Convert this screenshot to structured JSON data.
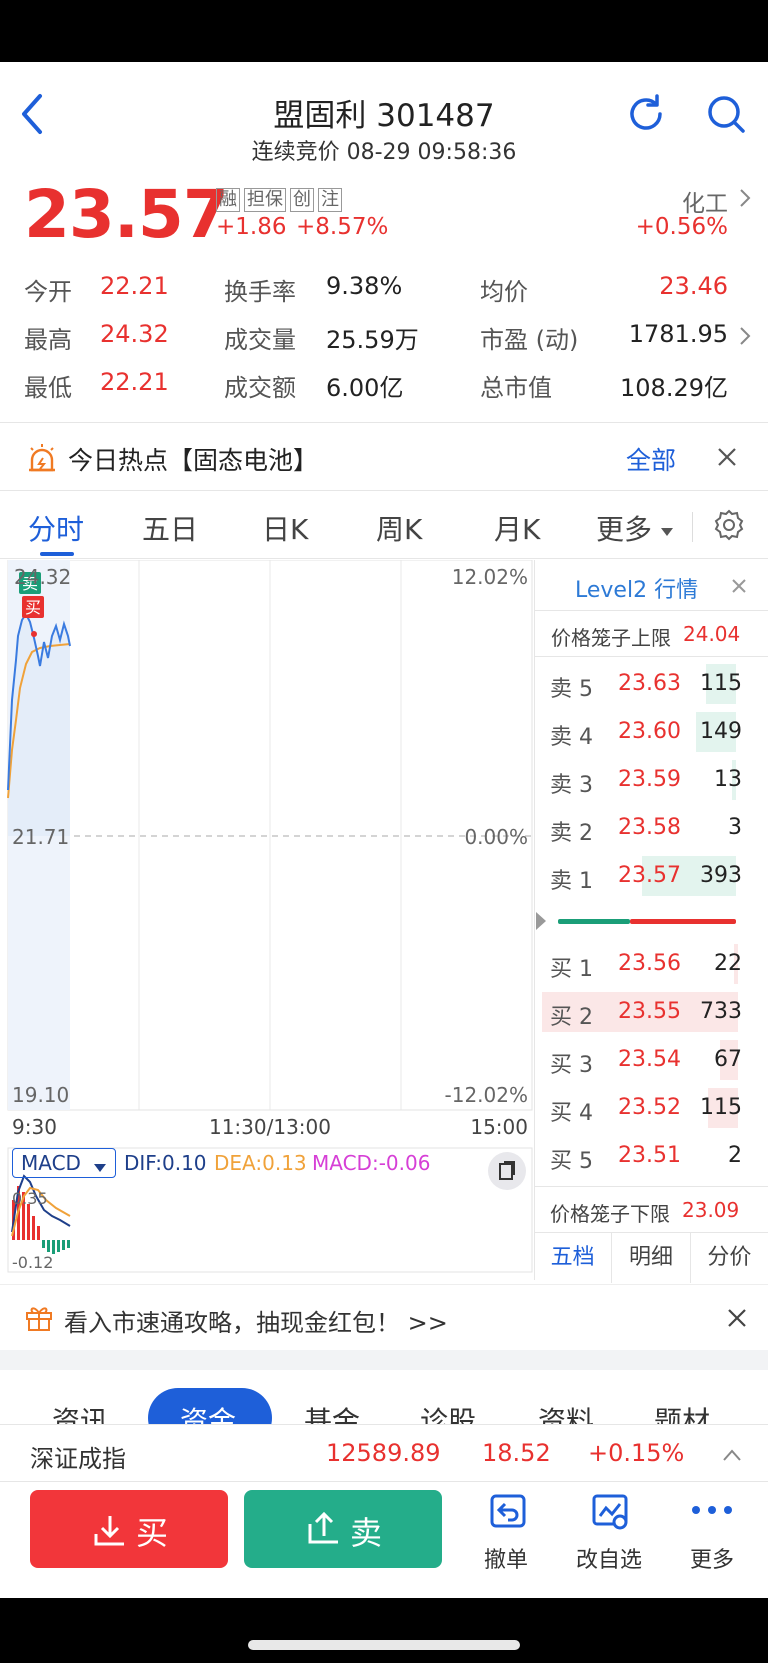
{
  "header": {
    "title": "盟固利 301487",
    "subtitle": "连续竞价 08-29 09:58:36"
  },
  "quote": {
    "price": "23.57",
    "change": "+1.86",
    "change_pct": "+8.57%",
    "tags": [
      "融",
      "担保",
      "创",
      "注"
    ],
    "sector": "化工",
    "sector_change": "+0.56%"
  },
  "stats": [
    {
      "label": "今开",
      "value": "22.21"
    },
    {
      "label": "换手率",
      "value": "9.38%"
    },
    {
      "label": "均价",
      "value": "23.46"
    },
    {
      "label": "最高",
      "value": "24.32"
    },
    {
      "label": "成交量",
      "value": "25.59万"
    },
    {
      "label": "市盈 (动)",
      "value": "1781.95"
    },
    {
      "label": "最低",
      "value": "22.21"
    },
    {
      "label": "成交额",
      "value": "6.00亿"
    },
    {
      "label": "总市值",
      "value": "108.29亿"
    }
  ],
  "hot": {
    "text": "今日热点【固态电池】",
    "all": "全部"
  },
  "tabs": [
    "分时",
    "五日",
    "日K",
    "周K",
    "月K",
    "更多"
  ],
  "chart": {
    "price_top": "24.32",
    "price_mid": "21.71",
    "price_bottom": "19.10",
    "pct_top": "12.02%",
    "pct_mid": "0.00%",
    "pct_bottom": "-12.02%",
    "time_start": "9:30",
    "time_mid": "11:30/13:00",
    "time_end": "15:00",
    "sell_mark": "卖",
    "buy_mark": "买"
  },
  "macd": {
    "selector": "MACD",
    "dif": "DIF:0.10",
    "dea": "DEA:0.13",
    "macd": "MACD:-0.06",
    "top": "0.35",
    "bottom": "-0.12"
  },
  "level2": {
    "title": "Level2 行情",
    "upper_label": "价格笼子上限",
    "upper_value": "24.04",
    "lower_label": "价格笼子下限",
    "lower_value": "23.09",
    "asks": [
      {
        "label": "卖 5",
        "price": "23.63",
        "vol": "115"
      },
      {
        "label": "卖 4",
        "price": "23.60",
        "vol": "149"
      },
      {
        "label": "卖 3",
        "price": "23.59",
        "vol": "13"
      },
      {
        "label": "卖 2",
        "price": "23.58",
        "vol": "3"
      },
      {
        "label": "卖 1",
        "price": "23.57",
        "vol": "393"
      }
    ],
    "bids": [
      {
        "label": "买 1",
        "price": "23.56",
        "vol": "22"
      },
      {
        "label": "买 2",
        "price": "23.55",
        "vol": "733"
      },
      {
        "label": "买 3",
        "price": "23.54",
        "vol": "67"
      },
      {
        "label": "买 4",
        "price": "23.52",
        "vol": "115"
      },
      {
        "label": "买 5",
        "price": "23.51",
        "vol": "2"
      }
    ],
    "tabs": [
      "五档",
      "明细",
      "分价"
    ]
  },
  "promo": {
    "text": "看入市速通攻略，抽现金红包！ >>"
  },
  "section_tabs": [
    "资讯",
    "资金",
    "基金",
    "诊股",
    "资料",
    "题材"
  ],
  "index": {
    "name": "深证成指",
    "value": "12589.89",
    "change": "18.52",
    "pct": "+0.15%"
  },
  "bottom": {
    "buy": "买",
    "sell": "卖",
    "cancel": "撤单",
    "edit": "改自选",
    "more": "更多"
  }
}
